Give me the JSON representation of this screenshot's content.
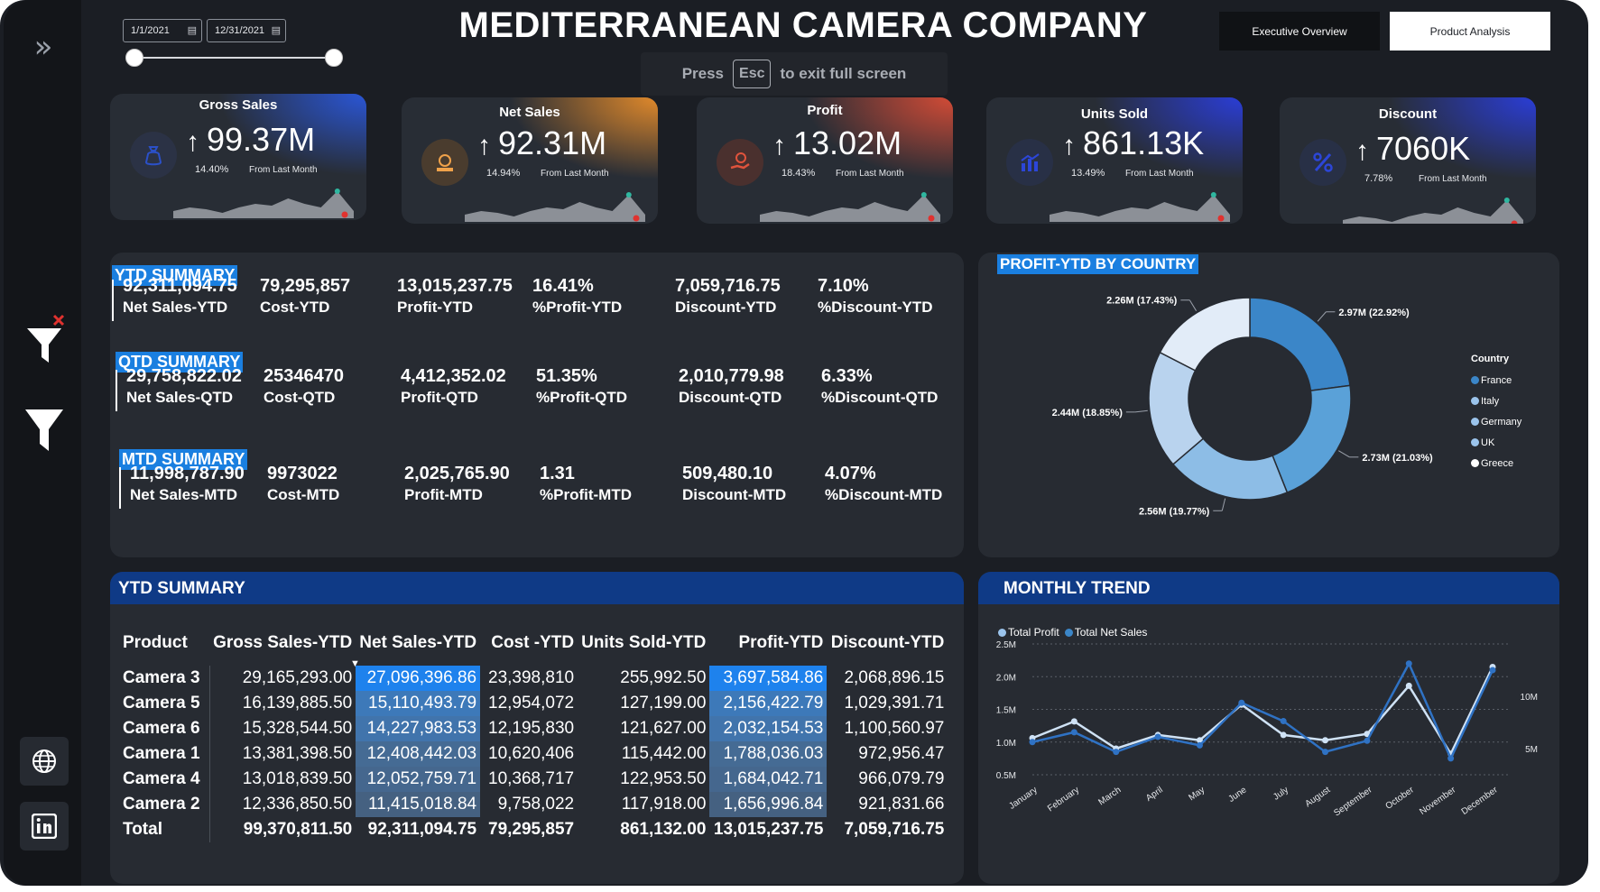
{
  "header": {
    "title": "MEDITERRANEAN CAMERA COMPANY",
    "tabs": [
      "Executive Overview",
      "Product Analysis"
    ],
    "active_tab": "Product Analysis"
  },
  "date_filter": {
    "start": "1/1/2021",
    "end": "12/31/2021"
  },
  "toast": {
    "press": "Press",
    "key": "Esc",
    "message": "to exit full screen"
  },
  "sidebar": {
    "icons": [
      "chevrons-right-icon",
      "clear-filter-icon",
      "filter-icon",
      "globe-icon",
      "linkedin-icon"
    ]
  },
  "kpis": [
    {
      "title": "Gross Sales",
      "value": "99.37M",
      "pct": "14.40%",
      "sub": "From Last Month",
      "icon": "money-bag-icon",
      "accent": "#2a56d6",
      "spark": [
        0.1,
        0.2,
        0.15,
        0.05,
        0.2,
        0.3,
        0.25,
        0.45,
        0.3,
        0.2,
        0.65,
        0.1
      ]
    },
    {
      "title": "Net Sales",
      "value": "92.31M",
      "pct": "14.94%",
      "sub": "From Last Month",
      "icon": "coins-icon",
      "accent": "#e0892b",
      "spark": [
        0.1,
        0.2,
        0.15,
        0.05,
        0.2,
        0.3,
        0.25,
        0.45,
        0.3,
        0.2,
        0.65,
        0.1
      ]
    },
    {
      "title": "Profit",
      "value": "13.02M",
      "pct": "18.43%",
      "sub": "From Last Month",
      "icon": "hand-coin-icon",
      "accent": "#d24b36",
      "spark": [
        0.1,
        0.2,
        0.15,
        0.05,
        0.2,
        0.3,
        0.25,
        0.45,
        0.3,
        0.2,
        0.65,
        0.1
      ]
    },
    {
      "title": "Units Sold",
      "value": "861.13K",
      "pct": "13.49%",
      "sub": "From Last Month",
      "icon": "bar-chart-icon",
      "accent": "#2a3dd6",
      "spark": [
        0.1,
        0.2,
        0.15,
        0.05,
        0.2,
        0.3,
        0.25,
        0.45,
        0.3,
        0.2,
        0.65,
        0.1
      ]
    },
    {
      "title": "Discount",
      "value": "7060K",
      "pct": "7.78%",
      "sub": "From Last Month",
      "icon": "percent-icon",
      "accent": "#2a3dd6",
      "spark": [
        0.1,
        0.2,
        0.15,
        0.05,
        0.2,
        0.3,
        0.25,
        0.45,
        0.3,
        0.2,
        0.65,
        0.1
      ]
    }
  ],
  "summary": {
    "ytd": {
      "label": "YTD SUMMARY",
      "values": [
        "92,311,094.75",
        "79,295,857",
        "13,015,237.75",
        "16.41%",
        "7,059,716.75",
        "7.10%"
      ],
      "labels": [
        "Net Sales-YTD",
        "Cost-YTD",
        "Profit-YTD",
        "%Profit-YTD",
        "Discount-YTD",
        "%Discount-YTD"
      ]
    },
    "qtd": {
      "label": "QTD SUMMARY",
      "values": [
        "29,758,822.02",
        "25346470",
        "4,412,352.02",
        "51.35%",
        "2,010,779.98",
        "6.33%"
      ],
      "labels": [
        "Net Sales-QTD",
        "Cost-QTD",
        "Profit-QTD",
        "%Profit-QTD",
        "Discount-QTD",
        "%Discount-QTD"
      ]
    },
    "mtd": {
      "label": "MTD SUMMARY",
      "values": [
        "11,998,787.90",
        "9973022",
        "2,025,765.90",
        "1.31",
        "509,480.10",
        "4.07%"
      ],
      "labels": [
        "Net Sales-MTD",
        "Cost-MTD",
        "Profit-MTD",
        "%Profit-MTD",
        "Discount-MTD",
        "%Discount-MTD"
      ]
    }
  },
  "pie": {
    "title": "PROFIT-YTD BY COUNTRY",
    "legend_title": "Country",
    "slices": [
      {
        "country": "France",
        "value": 2.97,
        "label": "2.97M (22.92%)",
        "color": "#3b86c8"
      },
      {
        "country": "Italy",
        "value": 2.73,
        "label": "2.73M (21.03%)",
        "color": "#5aa1d8"
      },
      {
        "country": "Germany",
        "value": 2.56,
        "label": "2.56M (19.77%)",
        "color": "#8dbde6"
      },
      {
        "country": "UK",
        "value": 2.44,
        "label": "2.44M (18.85%)",
        "color": "#b9d3ee"
      },
      {
        "country": "Greece",
        "value": 2.26,
        "label": "2.26M (17.43%)",
        "color": "#e2ecf8"
      }
    ]
  },
  "table": {
    "title": "YTD SUMMARY",
    "columns": [
      "Product",
      "Gross Sales-YTD",
      "Net Sales-YTD",
      "Cost -YTD",
      "Units Sold-YTD",
      "Profit-YTD",
      "Discount-YTD"
    ],
    "sorted_column": "Net Sales-YTD",
    "rows": [
      [
        "Camera 3",
        "29,165,293.00",
        "27,096,396.86",
        "23,398,810",
        "255,992.50",
        "3,697,584.86",
        "2,068,896.15"
      ],
      [
        "Camera 5",
        "16,139,885.50",
        "15,110,493.79",
        "12,954,072",
        "127,199.00",
        "2,156,422.79",
        "1,029,391.71"
      ],
      [
        "Camera 6",
        "15,328,544.50",
        "14,227,983.53",
        "12,195,830",
        "121,627.00",
        "2,032,154.53",
        "1,100,560.97"
      ],
      [
        "Camera 1",
        "13,381,398.50",
        "12,408,442.03",
        "10,620,406",
        "115,442.00",
        "1,788,036.03",
        "972,956.47"
      ],
      [
        "Camera 4",
        "13,018,839.50",
        "12,052,759.71",
        "10,368,717",
        "122,953.50",
        "1,684,042.71",
        "966,079.79"
      ],
      [
        "Camera 2",
        "12,336,850.50",
        "11,415,018.84",
        "9,758,022",
        "117,918.00",
        "1,656,996.84",
        "921,831.66"
      ]
    ],
    "total": [
      "Total",
      "99,370,811.50",
      "92,311,094.75",
      "79,295,857",
      "861,132.00",
      "13,015,237.75",
      "7,059,716.75"
    ],
    "net_sales_heat": [
      1.0,
      0.55,
      0.45,
      0.25,
      0.2,
      0.1
    ],
    "profit_heat": [
      1.0,
      0.55,
      0.45,
      0.25,
      0.2,
      0.1
    ]
  },
  "chart_data": {
    "type": "line",
    "title": "MONTHLY TREND",
    "categories": [
      "January",
      "February",
      "March",
      "April",
      "May",
      "June",
      "July",
      "August",
      "September",
      "October",
      "November",
      "December"
    ],
    "series": [
      {
        "name": "Total Profit",
        "axis": "left",
        "color": "#2f72c4",
        "values": [
          1.0,
          1.15,
          0.85,
          1.08,
          0.95,
          1.6,
          1.32,
          0.85,
          1.02,
          2.2,
          0.75,
          2.1
        ]
      },
      {
        "name": "Total Net Sales",
        "axis": "right",
        "color": "#cfe2f5",
        "values": [
          6.0,
          7.6,
          5.0,
          6.3,
          5.8,
          9.2,
          6.3,
          5.8,
          6.4,
          11.0,
          4.5,
          12.8
        ]
      }
    ],
    "y_left": {
      "ticks": [
        "0.5M",
        "1.0M",
        "1.5M",
        "2.0M",
        "2.5M"
      ],
      "range": [
        0.5,
        2.5
      ]
    },
    "y_right": {
      "ticks": [
        "5M",
        "10M"
      ],
      "range": [
        2.5,
        15.0
      ]
    },
    "legend": "top-left",
    "grid": true
  }
}
